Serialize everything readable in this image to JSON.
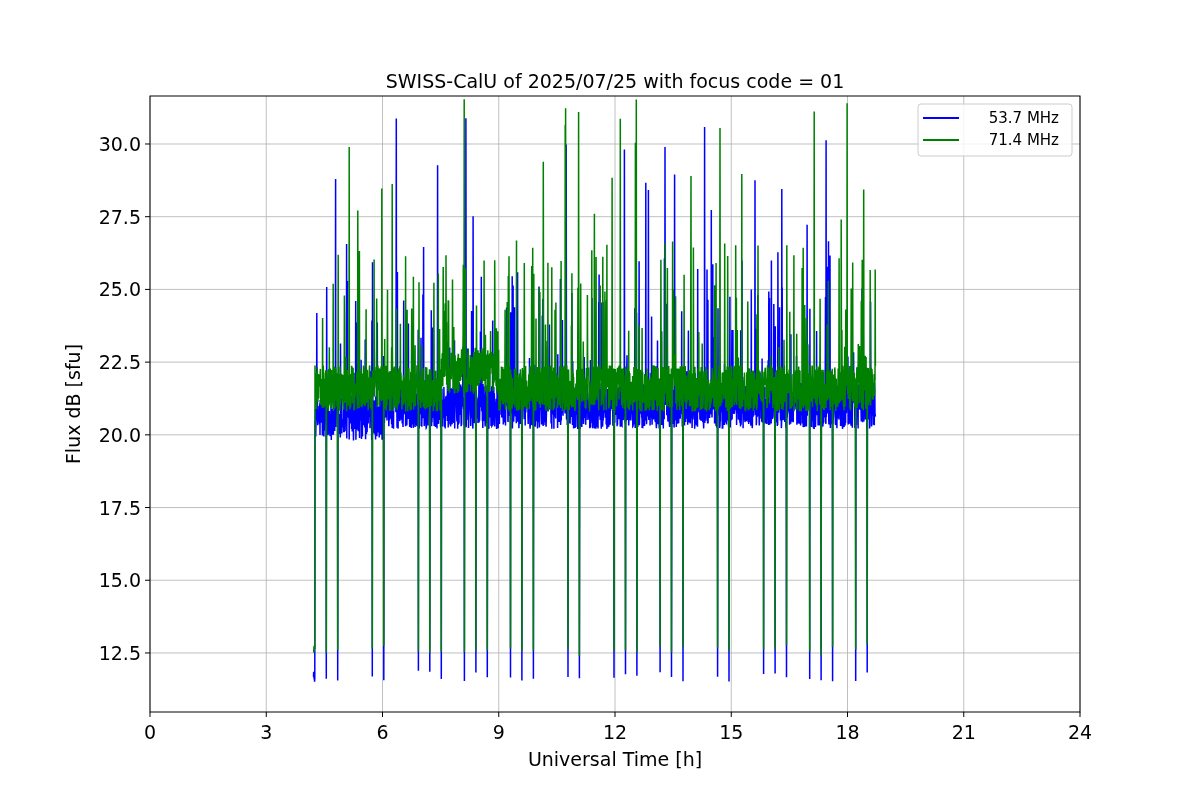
{
  "figure": {
    "title": "SWISS-CalU of 2025/07/25 with focus code = 01",
    "x_axis": {
      "label": "Universal Time [h]",
      "ticks": [
        "0",
        "3",
        "6",
        "9",
        "12",
        "15",
        "18",
        "21",
        "24"
      ]
    },
    "y_axis": {
      "label": "Flux dB [sfu]",
      "ticks": [
        "30.0",
        "27.5",
        "25.0",
        "22.5",
        "20.0",
        "17.5",
        "15.0",
        "12.5"
      ]
    },
    "legend": [
      {
        "label": "53.7 MHz",
        "color": "#0000ff"
      },
      {
        "label": "71.4 MHz",
        "color": "#008000"
      }
    ]
  }
}
